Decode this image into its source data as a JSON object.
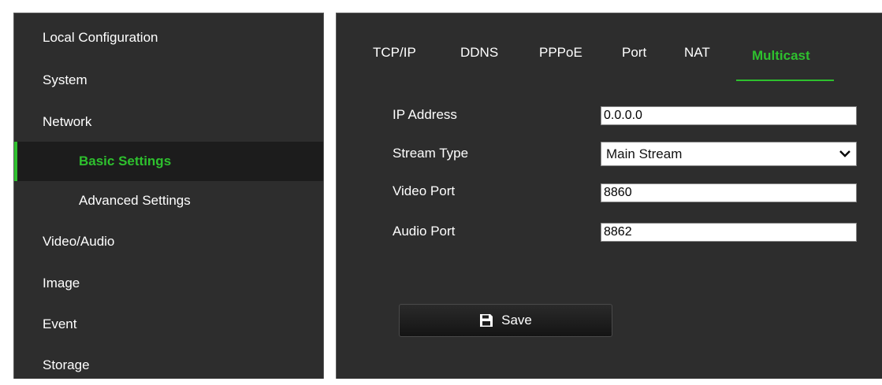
{
  "sidebar": {
    "items": [
      {
        "label": "Local Configuration"
      },
      {
        "label": "System"
      },
      {
        "label": "Network"
      },
      {
        "label": "Basic Settings"
      },
      {
        "label": "Advanced Settings"
      },
      {
        "label": "Video/Audio"
      },
      {
        "label": "Image"
      },
      {
        "label": "Event"
      },
      {
        "label": "Storage"
      }
    ],
    "active_item": "Basic Settings"
  },
  "tabs": [
    {
      "label": "TCP/IP"
    },
    {
      "label": "DDNS"
    },
    {
      "label": "PPPoE"
    },
    {
      "label": "Port"
    },
    {
      "label": "NAT"
    },
    {
      "label": "Multicast"
    }
  ],
  "active_tab": "Multicast",
  "form": {
    "ip_address": {
      "label": "IP Address",
      "value": "0.0.0.0"
    },
    "stream_type": {
      "label": "Stream Type",
      "value": "Main Stream"
    },
    "video_port": {
      "label": "Video Port",
      "value": "8860"
    },
    "audio_port": {
      "label": "Audio Port",
      "value": "8862"
    }
  },
  "save_button": {
    "label": "Save",
    "icon": "floppy-disk-icon"
  },
  "colors": {
    "accent": "#2ec02e",
    "panel": "#2d2d2d",
    "active_row": "#1c1c1c",
    "text": "#ffffff"
  }
}
